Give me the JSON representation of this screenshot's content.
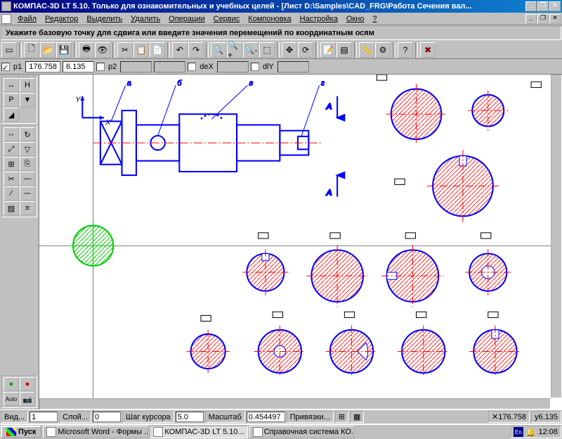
{
  "title": "КОМПАС-3D LT 5.10. Только для ознакомительных и учебных целей - [Лист D:\\Samples\\CAD_FRG\\Работа Сечения вал...",
  "menu": [
    "Файл",
    "Редактор",
    "Выделить",
    "Удалить",
    "Операции",
    "Сервис",
    "Компоновка",
    "Настройка",
    "Окно",
    "?"
  ],
  "hint": "Укажите базовую точку для сдвига или введите значения перемещений по координатным осям",
  "coords": {
    "p1_label": "p1",
    "p1_x": "176.758",
    "p1_y": "6.135",
    "p2_label": "p2",
    "dex_label": "deX",
    "dly_label": "dlY"
  },
  "status": {
    "vid": "Вид...",
    "vid_val": "1",
    "layer": "Слой...",
    "layer_val": "0",
    "step": "Шаг курсора",
    "step_val": "5.0",
    "scale": "Масштаб",
    "scale_val": "0.454497",
    "snap": "Привязки...",
    "x": "176.758",
    "y": "6.135"
  },
  "taskbar": {
    "start": "Пуск",
    "tasks": [
      "Microsoft Word - Формы ...",
      "КОМПАС-3D LT 5.10...",
      "Справочная система КО..."
    ],
    "lang": "En",
    "bell": "🔔",
    "clock": "12:08"
  },
  "drawing": {
    "labels": [
      "а",
      "б",
      "в",
      "г"
    ],
    "section": "А"
  }
}
